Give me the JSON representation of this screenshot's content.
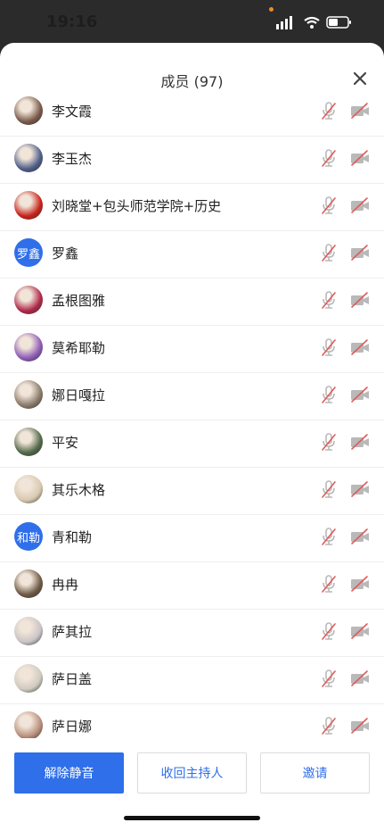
{
  "status": {
    "time": "19:16"
  },
  "header": {
    "title": "成员 (97)"
  },
  "members": [
    {
      "name": "李文霞",
      "avatar": "photo",
      "color": "#7a5a4b"
    },
    {
      "name": "李玉杰",
      "avatar": "photo",
      "color": "#4f5f89"
    },
    {
      "name": "刘晓堂+包头师范学院+历史",
      "avatar": "photo",
      "color": "#c8231b"
    },
    {
      "name": "罗鑫",
      "avatar": "text",
      "avatar_text": "罗鑫"
    },
    {
      "name": "孟根图雅",
      "avatar": "photo",
      "color": "#b02a4a"
    },
    {
      "name": "莫希耶勒",
      "avatar": "photo",
      "color": "#8e5cb7"
    },
    {
      "name": "娜日嘎拉",
      "avatar": "photo",
      "color": "#8a7b6b"
    },
    {
      "name": "平安",
      "avatar": "photo",
      "color": "#536a4a"
    },
    {
      "name": "其乐木格",
      "avatar": "photo",
      "color": "#d8c9b0"
    },
    {
      "name": "青和勒",
      "avatar": "text",
      "avatar_text": "和勒"
    },
    {
      "name": "冉冉",
      "avatar": "photo",
      "color": "#6e5a46"
    },
    {
      "name": "萨其拉",
      "avatar": "photo",
      "color": "#c9c4c6"
    },
    {
      "name": "萨日盖",
      "avatar": "photo",
      "color": "#cfcac0"
    },
    {
      "name": "萨日娜",
      "avatar": "photo",
      "color": "#b88f7c"
    }
  ],
  "actions": {
    "unmute": "解除静音",
    "reclaim_host": "收回主持人",
    "invite": "邀请"
  },
  "colors": {
    "accent": "#2f6fea",
    "muted_red": "#e05b5b"
  }
}
